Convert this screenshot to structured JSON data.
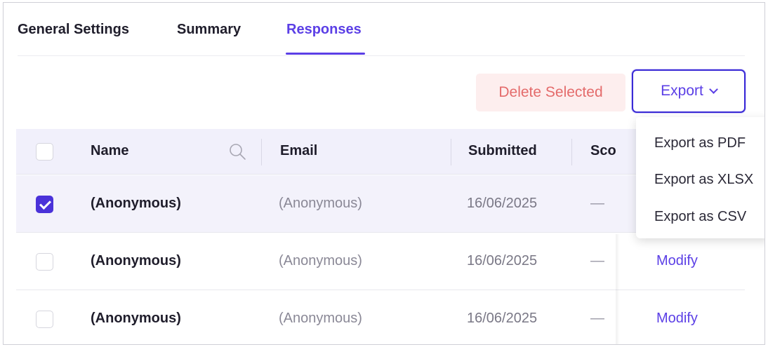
{
  "tabs": [
    {
      "label": "General Settings"
    },
    {
      "label": "Summary"
    },
    {
      "label": "Responses"
    }
  ],
  "active_tab": "Responses",
  "toolbar": {
    "delete_label": "Delete Selected",
    "export_label": "Export"
  },
  "export_menu": {
    "items": [
      {
        "label": "Export as PDF"
      },
      {
        "label": "Export as XLSX"
      },
      {
        "label": "Export as CSV"
      }
    ]
  },
  "table": {
    "headers": {
      "name": "Name",
      "email": "Email",
      "submitted": "Submitted",
      "score": "Sco"
    },
    "rows": [
      {
        "name": "(Anonymous)",
        "email": "(Anonymous)",
        "submitted": "16/06/2025",
        "score": "—",
        "action": "",
        "checked": true
      },
      {
        "name": "(Anonymous)",
        "email": "(Anonymous)",
        "submitted": "16/06/2025",
        "score": "—",
        "action": "Modify",
        "checked": false
      },
      {
        "name": "(Anonymous)",
        "email": "(Anonymous)",
        "submitted": "16/06/2025",
        "score": "—",
        "action": "Modify",
        "checked": false
      }
    ]
  },
  "colors": {
    "accent": "#5b3fe6",
    "checkbox_checked": "#4a32d9",
    "delete_bg": "#fdeeee",
    "delete_text": "#e46b6b",
    "header_bg": "#f1f0fb"
  },
  "icons": {
    "search": "search-icon",
    "chevron": "chevron-down-icon",
    "check": "checkmark-icon"
  }
}
